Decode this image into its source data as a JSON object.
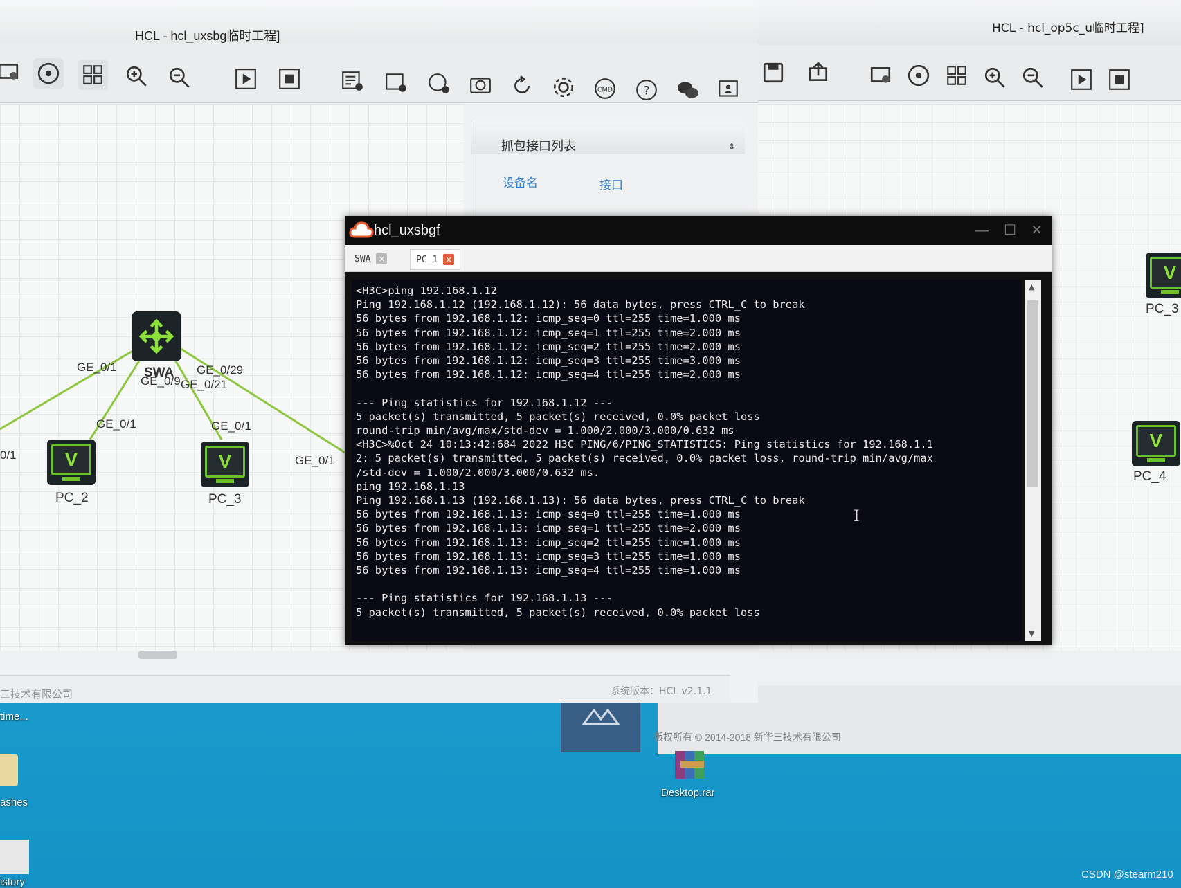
{
  "back_window": {
    "title": "HCL - hcl_op5c_u临时工程]",
    "nodes": [
      {
        "label": "PC_3"
      },
      {
        "label": "PC_4"
      }
    ],
    "copyright": "版权所有 © 2014-2018 新华三技术有限公司"
  },
  "front_window": {
    "title": "HCL - hcl_uxsbg临时工程]",
    "capture_panel": {
      "title": "抓包接口列表",
      "col_device": "设备名",
      "col_interface": "接口"
    },
    "status_left": "三技术有限公司",
    "status_right": "系统版本：HCL v2.1.1",
    "topology": {
      "switch_label": "SWA",
      "pcs": [
        {
          "label": "PC_2"
        },
        {
          "label": "PC_3"
        }
      ],
      "port_labels": {
        "sw_a": "GE_0/1",
        "sw_b": "GE_0/29",
        "sw_c": "GE_0/9",
        "sw_d": "GE_0/21",
        "pc2_port": "GE_0/1",
        "pc3_port": "GE_0/1",
        "edge_left": "0/1",
        "edge_right": "GE_0/1"
      }
    }
  },
  "terminal": {
    "title": "hcl_uxsbgf",
    "tabs": [
      {
        "label": "SWA",
        "active": false
      },
      {
        "label": "PC_1",
        "active": true
      }
    ],
    "lines": [
      "<H3C>ping 192.168.1.12",
      "Ping 192.168.1.12 (192.168.1.12): 56 data bytes, press CTRL_C to break",
      "56 bytes from 192.168.1.12: icmp_seq=0 ttl=255 time=1.000 ms",
      "56 bytes from 192.168.1.12: icmp_seq=1 ttl=255 time=2.000 ms",
      "56 bytes from 192.168.1.12: icmp_seq=2 ttl=255 time=2.000 ms",
      "56 bytes from 192.168.1.12: icmp_seq=3 ttl=255 time=3.000 ms",
      "56 bytes from 192.168.1.12: icmp_seq=4 ttl=255 time=2.000 ms",
      "",
      "--- Ping statistics for 192.168.1.12 ---",
      "5 packet(s) transmitted, 5 packet(s) received, 0.0% packet loss",
      "round-trip min/avg/max/std-dev = 1.000/2.000/3.000/0.632 ms",
      "<H3C>%Oct 24 10:13:42:684 2022 H3C PING/6/PING_STATISTICS: Ping statistics for 192.168.1.1",
      "2: 5 packet(s) transmitted, 5 packet(s) received, 0.0% packet loss, round-trip min/avg/max",
      "/std-dev = 1.000/2.000/3.000/0.632 ms.",
      "ping 192.168.1.13",
      "Ping 192.168.1.13 (192.168.1.13): 56 data bytes, press CTRL_C to break",
      "56 bytes from 192.168.1.13: icmp_seq=0 ttl=255 time=1.000 ms",
      "56 bytes from 192.168.1.13: icmp_seq=1 ttl=255 time=2.000 ms",
      "56 bytes from 192.168.1.13: icmp_seq=2 ttl=255 time=1.000 ms",
      "56 bytes from 192.168.1.13: icmp_seq=3 ttl=255 time=1.000 ms",
      "56 bytes from 192.168.1.13: icmp_seq=4 ttl=255 time=1.000 ms",
      "",
      "--- Ping statistics for 192.168.1.13 ---",
      "5 packet(s) transmitted, 5 packet(s) received, 0.0% packet loss"
    ]
  },
  "desktop": {
    "taskbar_text": "time...",
    "icons": [
      {
        "label": "ashes"
      },
      {
        "label": "Desktop.rar"
      },
      {
        "label": "istory"
      }
    ]
  },
  "watermark": "CSDN @stearm210",
  "colors": {
    "link_green": "#8ec63f",
    "accent_blue": "#2a7bd3",
    "terminal_bg": "#0a0a14"
  }
}
